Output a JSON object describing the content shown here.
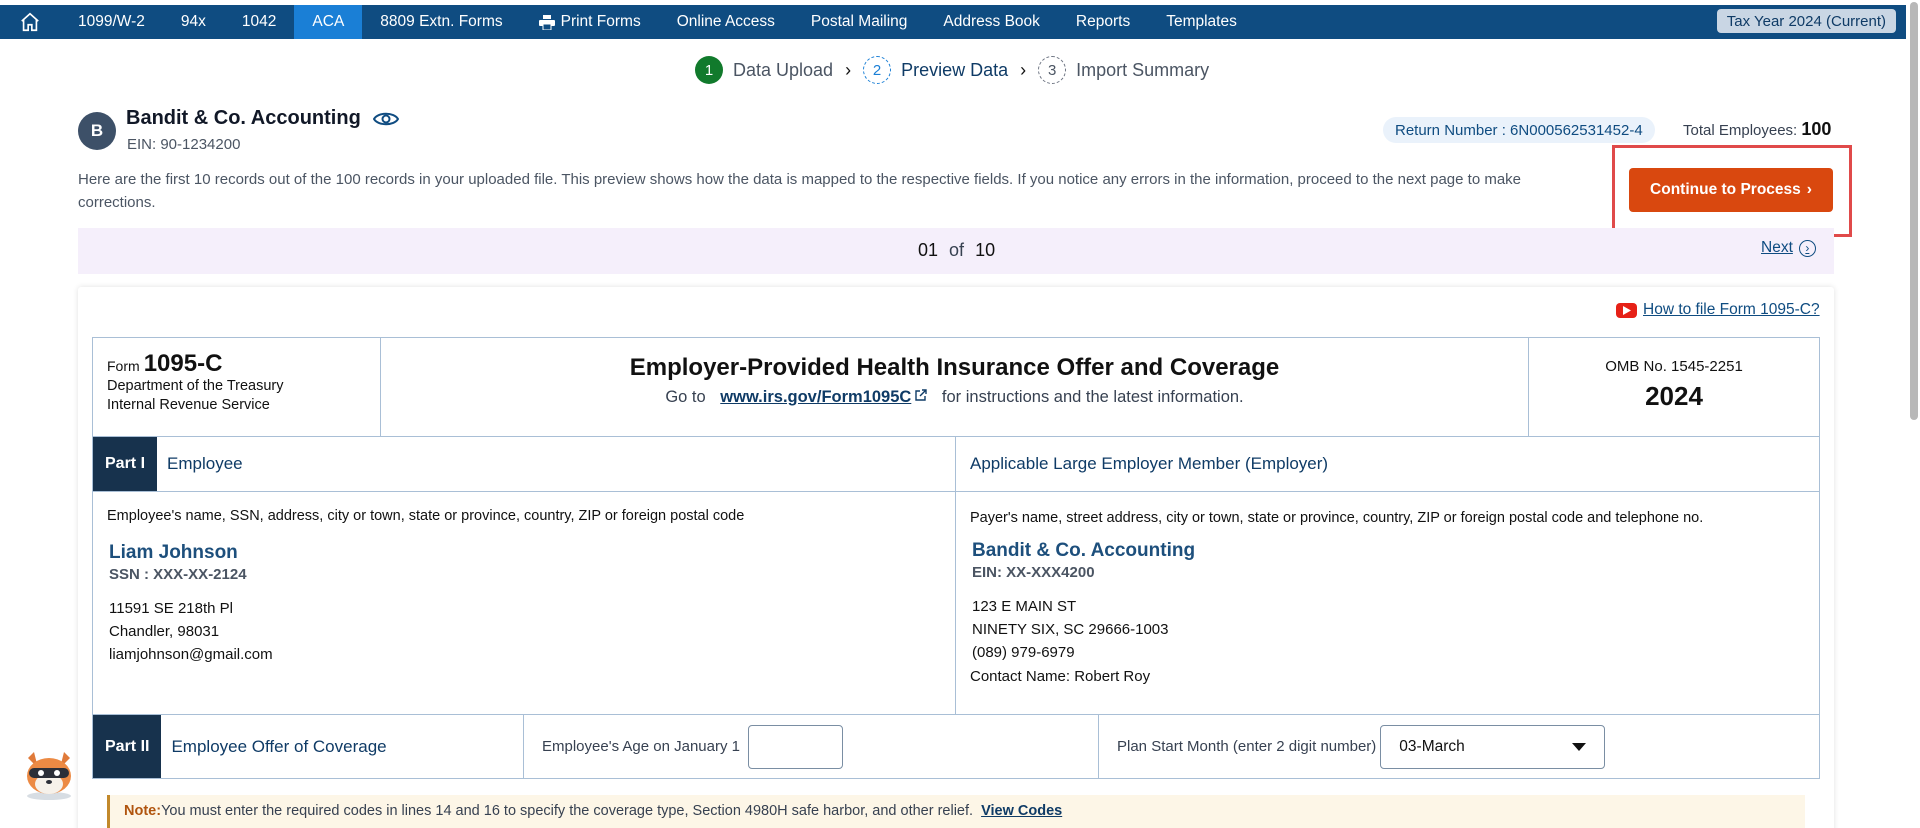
{
  "nav": {
    "items": [
      "1099/W-2",
      "94x",
      "1042",
      "ACA",
      "8809 Extn. Forms",
      "Print Forms",
      "Online Access",
      "Postal Mailing",
      "Address Book",
      "Reports",
      "Templates"
    ],
    "active": "ACA",
    "tax_year": "Tax Year 2024 (Current)"
  },
  "stepper": [
    {
      "num": "1",
      "label": "Data Upload"
    },
    {
      "num": "2",
      "label": "Preview Data"
    },
    {
      "num": "3",
      "label": "Import Summary"
    }
  ],
  "company": {
    "initial": "B",
    "name": "Bandit & Co. Accounting",
    "ein": "EIN: 90-1234200",
    "return_label": "Return Number :",
    "return_number": "6N000562531452-4",
    "total_label": "Total Employees:",
    "total_value": "100"
  },
  "description": "Here are the first 10 records out of the 100 records in your uploaded file. This preview shows how the data is mapped to the respective fields. If you notice any errors in the information, proceed to the next page to make corrections.",
  "continue_label": "Continue to Process",
  "pager": {
    "current": "01",
    "of": "of",
    "total": "10",
    "next": "Next"
  },
  "howto": "How to file Form 1095-C?",
  "form": {
    "form_word": "Form",
    "form_no": "1095-C",
    "dept1": "Department of the Treasury",
    "dept2": "Internal Revenue Service",
    "title": "Employer-Provided Health Insurance Offer and Coverage",
    "goto": "Go to",
    "link": "www.irs.gov/Form1095C",
    "instructions": "for instructions and the latest information.",
    "omb": "OMB No. 1545-2251",
    "year": "2024",
    "part1": "Part I",
    "part1_title": "Employee",
    "employer_title": "Applicable Large Employer Member (Employer)",
    "employee_label": "Employee's name, SSN, address, city or town, state or province, country, ZIP or foreign postal code",
    "employee_name": "Liam Johnson",
    "employee_ssn": "SSN : XXX-XX-2124",
    "employee_addr1": "11591 SE 218th Pl",
    "employee_addr2": "Chandler, 98031",
    "employee_email": "liamjohnson@gmail.com",
    "payer_label": "Payer's name, street address, city or town, state or province, country, ZIP or foreign postal code and telephone no.",
    "payer_name": "Bandit & Co. Accounting",
    "payer_ein": "EIN: XX-XXX4200",
    "payer_addr1": "123 E MAIN ST",
    "payer_addr2": "NINETY SIX, SC 29666-1003",
    "payer_phone": "(089) 979-6979",
    "contact_label": "Contact Name:",
    "contact_name": "Robert Roy",
    "part2": "Part II",
    "part2_title": "Employee Offer of Coverage",
    "age_label": "Employee's Age on January 1",
    "age_value": "",
    "plan_label": "Plan Start Month (enter 2 digit number)",
    "plan_value": "03-March"
  },
  "note": {
    "label": "Note:",
    "text": "You must enter the required codes in lines 14 and 16 to specify the coverage type, Section 4980H safe harbor, and other relief.",
    "link": "View Codes"
  },
  "icons": {
    "home": "home-icon",
    "printer": "printer-icon",
    "eye": "eye-icon",
    "youtube": "youtube-icon",
    "external": "external-link-icon",
    "next": "chevron-right-circle-icon"
  },
  "colors": {
    "nav_bg": "#0f4c81",
    "nav_active": "#1a7fd6",
    "cta": "#d9480f",
    "highlight": "#e04a4a"
  }
}
